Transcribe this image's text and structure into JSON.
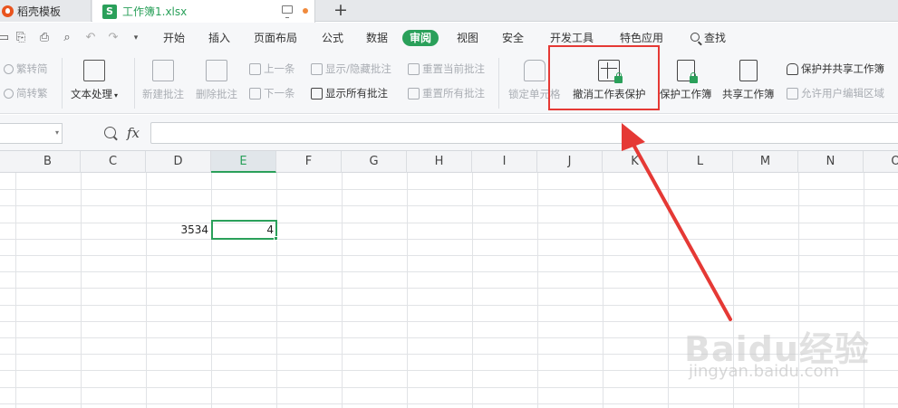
{
  "tabs": {
    "template_label": "稻壳模板",
    "file_label": "工作簿1.xlsx",
    "file_icon_letter": "S",
    "new_tab": "+"
  },
  "quick_access": [
    "open-icon",
    "save-icon",
    "print-icon",
    "preview-icon",
    "undo-icon",
    "redo-icon",
    "more-icon"
  ],
  "menu": {
    "items": [
      "开始",
      "插入",
      "页面布局",
      "公式",
      "数据",
      "审阅",
      "视图",
      "安全",
      "开发工具",
      "特色应用"
    ],
    "active": "审阅",
    "search_label": "查找"
  },
  "ribbon": {
    "trad_simplified": {
      "to_traditional": "繁转简",
      "to_simplified": "简转繁"
    },
    "text_processing": "文本处理",
    "new_comment": "新建批注",
    "delete_comment": "删除批注",
    "prev": "上一条",
    "next": "下一条",
    "show_hide_comment": "显示/隐藏批注",
    "show_all_comments": "显示所有批注",
    "reset_current_comment": "重置当前批注",
    "reset_all_comments": "重置所有批注",
    "lock_cell": "锁定单元格",
    "unprotect_sheet": "撤消工作表保护",
    "protect_workbook": "保护工作簿",
    "share_workbook": "共享工作簿",
    "protect_and_share": "保护并共享工作簿",
    "allow_edit_ranges": "允许用户编辑区域"
  },
  "formula_bar": {
    "fx_label": "fx",
    "value": ""
  },
  "grid": {
    "columns": [
      "B",
      "C",
      "D",
      "E",
      "F",
      "G",
      "H",
      "I",
      "J",
      "K",
      "L",
      "M",
      "N",
      "O"
    ],
    "selected_column": "E",
    "cells": {
      "D": "3534",
      "E": "4"
    }
  },
  "watermark": {
    "brand": "Baidu经验",
    "url": "jingyan.baidu.com"
  },
  "colors": {
    "accent_green": "#2aa05a",
    "annotation_red": "#e53935"
  }
}
